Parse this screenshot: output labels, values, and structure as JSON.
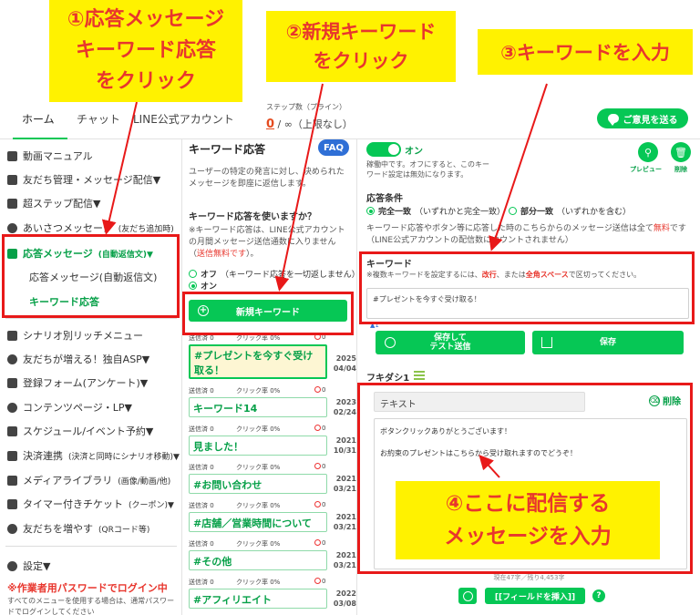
{
  "nav": {
    "tabs": [
      "ホーム",
      "チャット",
      "LINE公式アカウント"
    ],
    "step_label": "ステップ数（プライン）",
    "step_zero": "0",
    "step_rest": "/ ∞（上限なし）",
    "opinion_btn": "ご意見を送る"
  },
  "sidebar": {
    "items": [
      {
        "label": "動画マニュアル",
        "icon": "video-icon"
      },
      {
        "label": "友だち管理・メッセージ配信▼",
        "icon": "person-icon"
      },
      {
        "label": "超ステップ配信▼",
        "icon": "step-icon"
      },
      {
        "label": "あいさつメッセージ",
        "small": "(友だち追加時)",
        "icon": "hand-icon"
      },
      {
        "label": "応答メッセージ",
        "small": "(自動返信文)▼",
        "icon": "reply-icon"
      },
      {
        "label": "シナリオ別リッチメニュー",
        "icon": "phone-icon"
      },
      {
        "label": "友だちが増える！独自ASP▼",
        "icon": "people-icon"
      },
      {
        "label": "登録フォーム(アンケート)▼",
        "icon": "form-icon"
      },
      {
        "label": "コンテンツページ・LP▼",
        "icon": "globe-icon"
      },
      {
        "label": "スケジュール/イベント予約▼",
        "icon": "calendar-icon"
      },
      {
        "label": "決済連携",
        "small": "(決済と同時にシナリオ移動)▼",
        "icon": "card-icon"
      },
      {
        "label": "メディアライブラリ",
        "small": "(画像/動画/他)",
        "icon": "folder-icon"
      },
      {
        "label": "タイマー付きチケット",
        "small": "(クーポン)▼",
        "icon": "ticket-icon"
      },
      {
        "label": "友だちを増やす",
        "small": "(QRコード等)",
        "icon": "add-friend-icon"
      },
      {
        "label": "設定▼",
        "icon": "gear-icon"
      }
    ],
    "sub_reply": "応答メッセージ(自動返信文)",
    "sub_keyword": "キーワード応答",
    "warn": "※作業者用パスワードでログイン中",
    "note": "すべてのメニューを使用する場合は、通常パスワードでログインしてください"
  },
  "mid": {
    "title": "キーワード応答",
    "faq": "FAQ",
    "desc": "ユーザーの特定の発言に対し、決められたメッセージを即座に返信します。",
    "question": "キーワード応答を使いますか？",
    "note_pre": "※キーワード応答は、LINE公式アカウントの月間メッセージ送信通数に入りません（",
    "note_red": "送信無料です",
    "note_post": "）。",
    "off_label": "オフ",
    "off_sub": "（キーワード応答を一切返しません）",
    "on_label": "オン",
    "new_btn": "新規キーワード",
    "stat_sent": "送信済 0",
    "stat_click": "クリック率 0%",
    "stat_stop": "0",
    "keywords": [
      {
        "text": "#プレゼントを今すぐ受け取る！",
        "year": "2025",
        "date": "04/04"
      },
      {
        "text": "キーワード14",
        "year": "2023",
        "date": "02/24"
      },
      {
        "text": "見ました！",
        "year": "2021",
        "date": "10/31"
      },
      {
        "text": "#お問い合わせ",
        "year": "2021",
        "date": "03/21"
      },
      {
        "text": "#店舗／営業時間について",
        "year": "2021",
        "date": "03/21"
      },
      {
        "text": "#その他",
        "year": "2021",
        "date": "03/21"
      },
      {
        "text": "#アフィリエイト",
        "year": "2022",
        "date": "03/08"
      }
    ]
  },
  "detail": {
    "toggle_label": "オン",
    "toggle_desc": "稼働中です。オフにすると、このキーワード設定は無効になります。",
    "preview": "プレビュー",
    "delete": "削除",
    "cond_title": "応答条件",
    "cond_exact": "完全一致",
    "cond_exact_sub": "（いずれかと完全一致）",
    "cond_partial": "部分一致",
    "cond_partial_sub": "（いずれかを含む）",
    "cond_note_pre": "キーワード応答やボタン等に応答した時のこちらからのメッセージ送信は全て",
    "cond_note_red": "無料",
    "cond_note_post": "です（LINE公式アカウントの配信数にカウントされません）",
    "kw_label": "キーワード",
    "kw_hint_pre": "※複数キーワードを設定するには、",
    "kw_hint_red1": "改行",
    "kw_hint_mid": "、または",
    "kw_hint_red2": "全角スペース",
    "kw_hint_post": "で区切ってください。",
    "kw_value": "#プレゼントを今すぐ受け取る！",
    "kw_count": "▲1",
    "save_test": "保存して\nテスト送信",
    "save": "保存",
    "bubble_title": "フキダシ1",
    "type_value": "テキスト",
    "bubble_delete": "削除",
    "msg_line1": "ボタンクリックありがとうございます！",
    "msg_line2": "お約束のプレゼントはこちらから受け取れますのでどうぞ！",
    "char_count": "現在47字／残り4,453字",
    "field_btn": "[[フィールドを挿入]]",
    "help": "?"
  },
  "callouts": {
    "c1": [
      "①応答メッセージ",
      "キーワード応答",
      "をクリック"
    ],
    "c2": [
      "②新規キーワード",
      "をクリック"
    ],
    "c3": [
      "③キーワードを入力"
    ],
    "c4": [
      "④ここに配信する",
      "メッセージを入力"
    ]
  },
  "colors": {
    "brand": "#06c755",
    "callout_bg": "#fff200",
    "callout_text": "#e8362d",
    "frame": "#e81919"
  }
}
